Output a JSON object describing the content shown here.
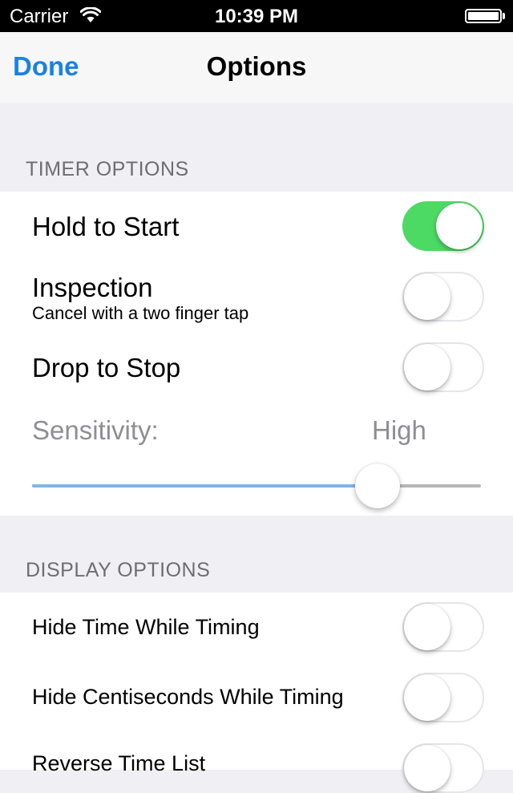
{
  "status_bar": {
    "carrier": "Carrier",
    "time": "10:39 PM",
    "wifi_icon": "wifi-icon",
    "battery_icon": "battery-icon"
  },
  "nav": {
    "done_label": "Done",
    "title": "Options"
  },
  "timer_options": {
    "header": "TIMER OPTIONS",
    "hold_to_start": {
      "label": "Hold to Start",
      "on": true
    },
    "inspection": {
      "label": "Inspection",
      "sublabel": "Cancel with a two finger tap",
      "on": false
    },
    "drop_to_stop": {
      "label": "Drop to Stop",
      "on": false
    },
    "sensitivity": {
      "label": "Sensitivity:",
      "value_label": "High",
      "level": 0.77
    }
  },
  "display_options": {
    "header": "DISPLAY OPTIONS",
    "hide_time": {
      "label": "Hide Time While Timing",
      "on": false
    },
    "hide_centiseconds": {
      "label": "Hide Centiseconds While Timing",
      "on": false
    },
    "reverse_time_list": {
      "label": "Reverse Time List",
      "on": false
    }
  },
  "colors": {
    "accent_blue": "#1a82e2",
    "toggle_on_green": "#4cd964",
    "slider_fill": "#7db6e8"
  }
}
